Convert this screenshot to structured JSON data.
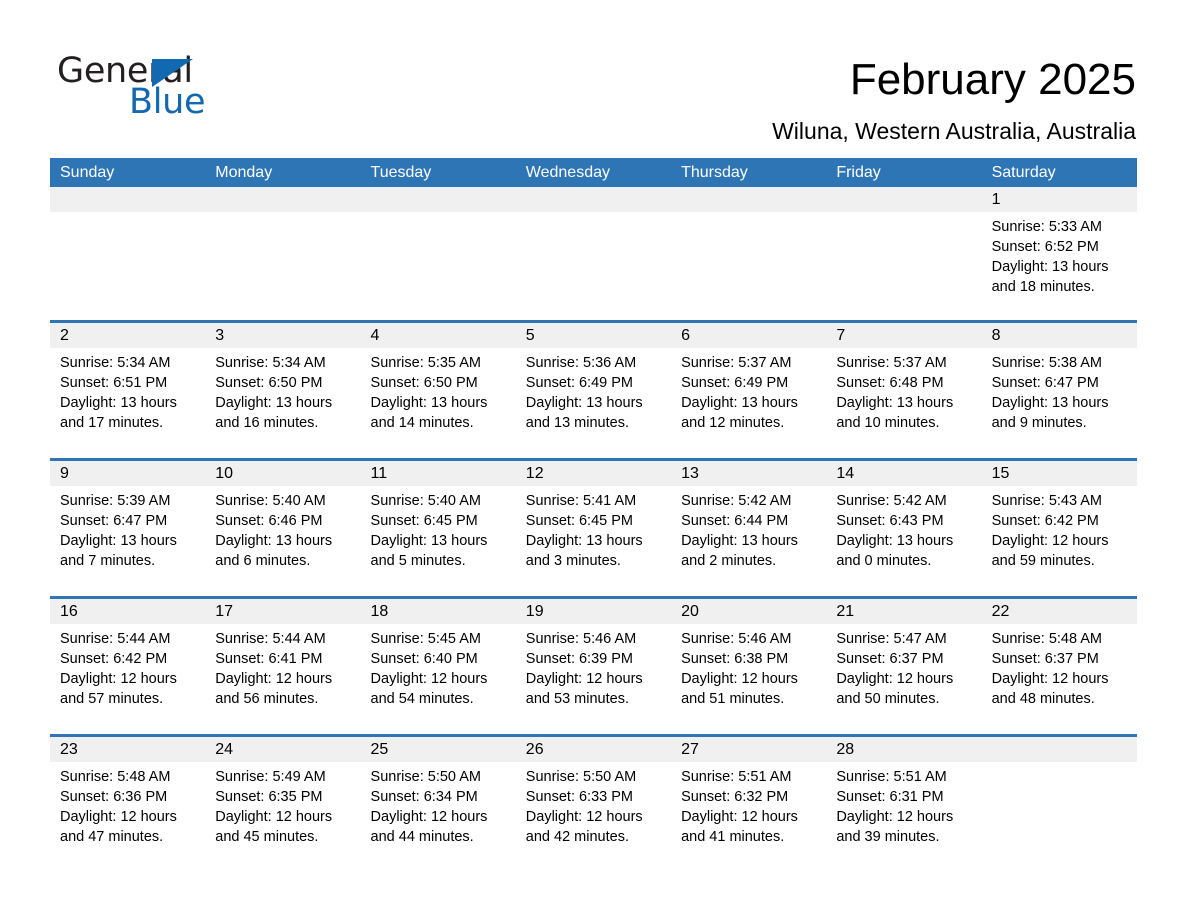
{
  "brand": {
    "name_part1": "General",
    "name_part2": "Blue",
    "triangle_icon": "triangle-icon",
    "accent_color": "#1269b0"
  },
  "header": {
    "title": "February 2025",
    "subtitle": "Wiluna, Western Australia, Australia"
  },
  "colors": {
    "header_blue": "#2e75b6",
    "day_band_gray": "#f0f0f0",
    "text": "#000000",
    "header_text": "#ffffff"
  },
  "calendar": {
    "weekday_headers": [
      "Sunday",
      "Monday",
      "Tuesday",
      "Wednesday",
      "Thursday",
      "Friday",
      "Saturday"
    ],
    "labels": {
      "sunrise": "Sunrise:",
      "sunset": "Sunset:",
      "daylight": "Daylight:"
    },
    "weeks": [
      [
        {
          "day": "",
          "sunrise": "",
          "sunset": "",
          "daylight_line1": "",
          "daylight_line2": ""
        },
        {
          "day": "",
          "sunrise": "",
          "sunset": "",
          "daylight_line1": "",
          "daylight_line2": ""
        },
        {
          "day": "",
          "sunrise": "",
          "sunset": "",
          "daylight_line1": "",
          "daylight_line2": ""
        },
        {
          "day": "",
          "sunrise": "",
          "sunset": "",
          "daylight_line1": "",
          "daylight_line2": ""
        },
        {
          "day": "",
          "sunrise": "",
          "sunset": "",
          "daylight_line1": "",
          "daylight_line2": ""
        },
        {
          "day": "",
          "sunrise": "",
          "sunset": "",
          "daylight_line1": "",
          "daylight_line2": ""
        },
        {
          "day": "1",
          "sunrise": "Sunrise: 5:33 AM",
          "sunset": "Sunset: 6:52 PM",
          "daylight_line1": "Daylight: 13 hours",
          "daylight_line2": "and 18 minutes."
        }
      ],
      [
        {
          "day": "2",
          "sunrise": "Sunrise: 5:34 AM",
          "sunset": "Sunset: 6:51 PM",
          "daylight_line1": "Daylight: 13 hours",
          "daylight_line2": "and 17 minutes."
        },
        {
          "day": "3",
          "sunrise": "Sunrise: 5:34 AM",
          "sunset": "Sunset: 6:50 PM",
          "daylight_line1": "Daylight: 13 hours",
          "daylight_line2": "and 16 minutes."
        },
        {
          "day": "4",
          "sunrise": "Sunrise: 5:35 AM",
          "sunset": "Sunset: 6:50 PM",
          "daylight_line1": "Daylight: 13 hours",
          "daylight_line2": "and 14 minutes."
        },
        {
          "day": "5",
          "sunrise": "Sunrise: 5:36 AM",
          "sunset": "Sunset: 6:49 PM",
          "daylight_line1": "Daylight: 13 hours",
          "daylight_line2": "and 13 minutes."
        },
        {
          "day": "6",
          "sunrise": "Sunrise: 5:37 AM",
          "sunset": "Sunset: 6:49 PM",
          "daylight_line1": "Daylight: 13 hours",
          "daylight_line2": "and 12 minutes."
        },
        {
          "day": "7",
          "sunrise": "Sunrise: 5:37 AM",
          "sunset": "Sunset: 6:48 PM",
          "daylight_line1": "Daylight: 13 hours",
          "daylight_line2": "and 10 minutes."
        },
        {
          "day": "8",
          "sunrise": "Sunrise: 5:38 AM",
          "sunset": "Sunset: 6:47 PM",
          "daylight_line1": "Daylight: 13 hours",
          "daylight_line2": "and 9 minutes."
        }
      ],
      [
        {
          "day": "9",
          "sunrise": "Sunrise: 5:39 AM",
          "sunset": "Sunset: 6:47 PM",
          "daylight_line1": "Daylight: 13 hours",
          "daylight_line2": "and 7 minutes."
        },
        {
          "day": "10",
          "sunrise": "Sunrise: 5:40 AM",
          "sunset": "Sunset: 6:46 PM",
          "daylight_line1": "Daylight: 13 hours",
          "daylight_line2": "and 6 minutes."
        },
        {
          "day": "11",
          "sunrise": "Sunrise: 5:40 AM",
          "sunset": "Sunset: 6:45 PM",
          "daylight_line1": "Daylight: 13 hours",
          "daylight_line2": "and 5 minutes."
        },
        {
          "day": "12",
          "sunrise": "Sunrise: 5:41 AM",
          "sunset": "Sunset: 6:45 PM",
          "daylight_line1": "Daylight: 13 hours",
          "daylight_line2": "and 3 minutes."
        },
        {
          "day": "13",
          "sunrise": "Sunrise: 5:42 AM",
          "sunset": "Sunset: 6:44 PM",
          "daylight_line1": "Daylight: 13 hours",
          "daylight_line2": "and 2 minutes."
        },
        {
          "day": "14",
          "sunrise": "Sunrise: 5:42 AM",
          "sunset": "Sunset: 6:43 PM",
          "daylight_line1": "Daylight: 13 hours",
          "daylight_line2": "and 0 minutes."
        },
        {
          "day": "15",
          "sunrise": "Sunrise: 5:43 AM",
          "sunset": "Sunset: 6:42 PM",
          "daylight_line1": "Daylight: 12 hours",
          "daylight_line2": "and 59 minutes."
        }
      ],
      [
        {
          "day": "16",
          "sunrise": "Sunrise: 5:44 AM",
          "sunset": "Sunset: 6:42 PM",
          "daylight_line1": "Daylight: 12 hours",
          "daylight_line2": "and 57 minutes."
        },
        {
          "day": "17",
          "sunrise": "Sunrise: 5:44 AM",
          "sunset": "Sunset: 6:41 PM",
          "daylight_line1": "Daylight: 12 hours",
          "daylight_line2": "and 56 minutes."
        },
        {
          "day": "18",
          "sunrise": "Sunrise: 5:45 AM",
          "sunset": "Sunset: 6:40 PM",
          "daylight_line1": "Daylight: 12 hours",
          "daylight_line2": "and 54 minutes."
        },
        {
          "day": "19",
          "sunrise": "Sunrise: 5:46 AM",
          "sunset": "Sunset: 6:39 PM",
          "daylight_line1": "Daylight: 12 hours",
          "daylight_line2": "and 53 minutes."
        },
        {
          "day": "20",
          "sunrise": "Sunrise: 5:46 AM",
          "sunset": "Sunset: 6:38 PM",
          "daylight_line1": "Daylight: 12 hours",
          "daylight_line2": "and 51 minutes."
        },
        {
          "day": "21",
          "sunrise": "Sunrise: 5:47 AM",
          "sunset": "Sunset: 6:37 PM",
          "daylight_line1": "Daylight: 12 hours",
          "daylight_line2": "and 50 minutes."
        },
        {
          "day": "22",
          "sunrise": "Sunrise: 5:48 AM",
          "sunset": "Sunset: 6:37 PM",
          "daylight_line1": "Daylight: 12 hours",
          "daylight_line2": "and 48 minutes."
        }
      ],
      [
        {
          "day": "23",
          "sunrise": "Sunrise: 5:48 AM",
          "sunset": "Sunset: 6:36 PM",
          "daylight_line1": "Daylight: 12 hours",
          "daylight_line2": "and 47 minutes."
        },
        {
          "day": "24",
          "sunrise": "Sunrise: 5:49 AM",
          "sunset": "Sunset: 6:35 PM",
          "daylight_line1": "Daylight: 12 hours",
          "daylight_line2": "and 45 minutes."
        },
        {
          "day": "25",
          "sunrise": "Sunrise: 5:50 AM",
          "sunset": "Sunset: 6:34 PM",
          "daylight_line1": "Daylight: 12 hours",
          "daylight_line2": "and 44 minutes."
        },
        {
          "day": "26",
          "sunrise": "Sunrise: 5:50 AM",
          "sunset": "Sunset: 6:33 PM",
          "daylight_line1": "Daylight: 12 hours",
          "daylight_line2": "and 42 minutes."
        },
        {
          "day": "27",
          "sunrise": "Sunrise: 5:51 AM",
          "sunset": "Sunset: 6:32 PM",
          "daylight_line1": "Daylight: 12 hours",
          "daylight_line2": "and 41 minutes."
        },
        {
          "day": "28",
          "sunrise": "Sunrise: 5:51 AM",
          "sunset": "Sunset: 6:31 PM",
          "daylight_line1": "Daylight: 12 hours",
          "daylight_line2": "and 39 minutes."
        },
        {
          "day": "",
          "sunrise": "",
          "sunset": "",
          "daylight_line1": "",
          "daylight_line2": ""
        }
      ]
    ]
  }
}
